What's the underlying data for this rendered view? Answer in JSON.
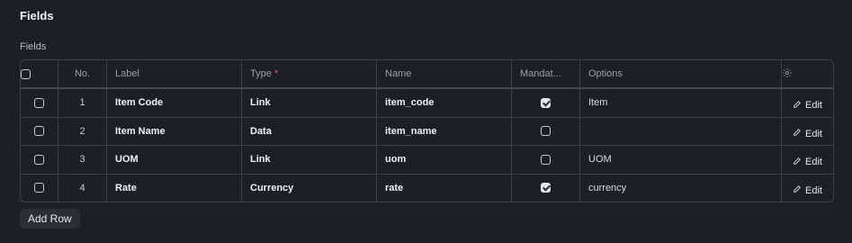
{
  "section": {
    "title": "Fields"
  },
  "table": {
    "field_label": "Fields",
    "headers": {
      "no": "No.",
      "label": "Label",
      "type": "Type",
      "type_required": "*",
      "name": "Name",
      "mandatory": "Mandat...",
      "options": "Options"
    },
    "rows": [
      {
        "no": "1",
        "label": "Item Code",
        "type": "Link",
        "name": "item_code",
        "mandatory": true,
        "options": "Item",
        "edit": "Edit"
      },
      {
        "no": "2",
        "label": "Item Name",
        "type": "Data",
        "name": "item_name",
        "mandatory": false,
        "options": "",
        "edit": "Edit"
      },
      {
        "no": "3",
        "label": "UOM",
        "type": "Link",
        "name": "uom",
        "mandatory": false,
        "options": "UOM",
        "edit": "Edit"
      },
      {
        "no": "4",
        "label": "Rate",
        "type": "Currency",
        "name": "rate",
        "mandatory": true,
        "options": "currency",
        "edit": "Edit"
      }
    ]
  },
  "actions": {
    "add_row": "Add Row"
  },
  "icons": {
    "settings": "gear-icon",
    "edit": "pencil-icon"
  }
}
